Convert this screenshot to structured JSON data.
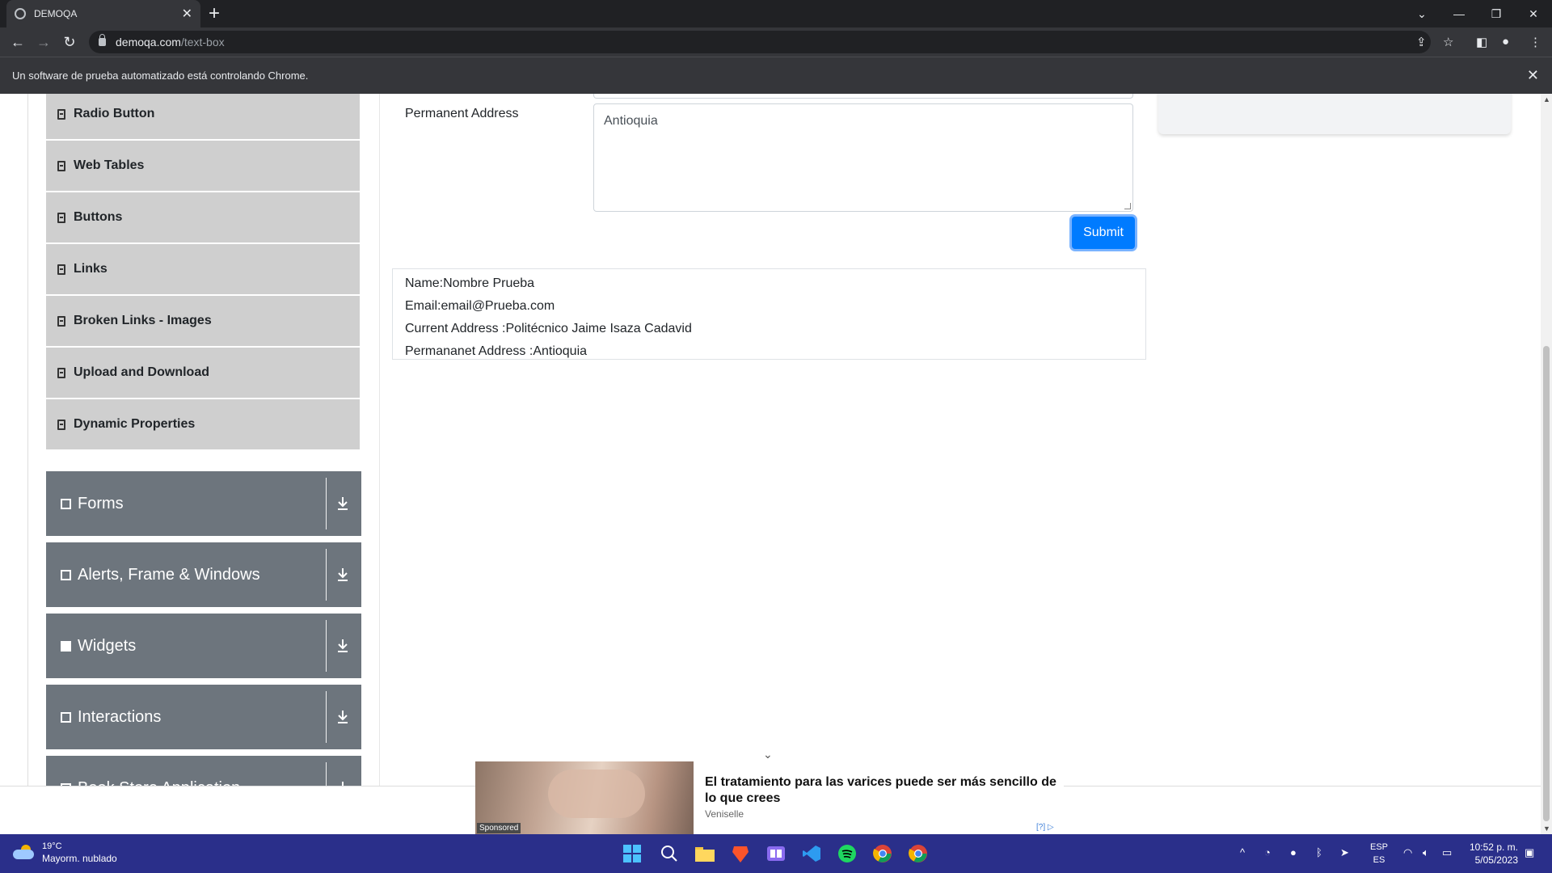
{
  "browser": {
    "tab_title": "DEMOQA",
    "tab_close": "✕",
    "new_tab": "+",
    "url_domain": "demoqa.com",
    "url_path": "/text-box",
    "infobar_text": "Un software de prueba automatizado está controlando Chrome.",
    "infobar_close": "✕"
  },
  "sidebar": {
    "elements_items": [
      {
        "label": "Radio Button"
      },
      {
        "label": "Web Tables"
      },
      {
        "label": "Buttons"
      },
      {
        "label": "Links"
      },
      {
        "label": "Broken Links - Images"
      },
      {
        "label": "Upload and Download"
      },
      {
        "label": "Dynamic Properties"
      }
    ],
    "groups": [
      {
        "label": "Forms"
      },
      {
        "label": "Alerts, Frame & Windows"
      },
      {
        "label": "Widgets"
      },
      {
        "label": "Interactions"
      },
      {
        "label": "Book Store Application"
      }
    ]
  },
  "form": {
    "permanent_address_label": "Permanent Address",
    "permanent_address_value": "Antioquia",
    "submit_label": "Submit"
  },
  "output": {
    "name": "Name:Nombre Prueba",
    "email": "Email:email@Prueba.com",
    "current_address": "Current Address :Politécnico Jaime Isaza Cadavid",
    "permanent_address": "Permananet Address :Antioquia"
  },
  "ad": {
    "title": "El tratamiento para las varices puede ser más sencillo de lo que crees",
    "brand": "Veniselle",
    "sponsored": "Sponsored",
    "info": "[?]"
  },
  "taskbar": {
    "temperature": "19°C",
    "weather": "Mayorm. nublado",
    "lang_1": "ESP",
    "lang_2": "ES",
    "time": "10:52 p. m.",
    "date": "5/05/2023"
  },
  "colors": {
    "primary": "#007bff",
    "group_bg": "#6d757d",
    "subitem_bg": "#cfcfcf",
    "taskbar": "#2a2f8a"
  }
}
